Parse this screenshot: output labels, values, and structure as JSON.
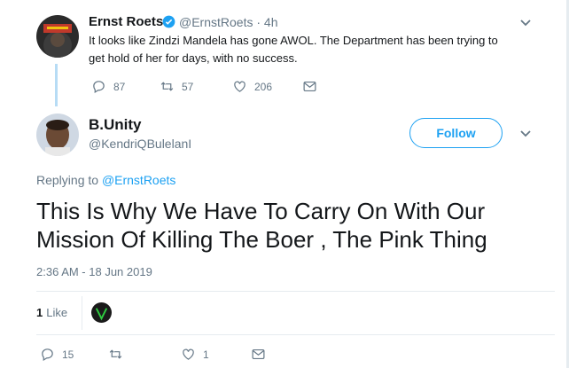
{
  "original_tweet": {
    "display_name": "Ernst Roets",
    "handle_time": "@ErnstRoets · 4h",
    "text": "It looks like Zindzi Mandela has gone AWOL. The Department has been trying to get hold of her for days, with no success.",
    "replies": "87",
    "retweets": "57",
    "likes": "206"
  },
  "reply_tweet": {
    "display_name": "B.Unity",
    "handle": "@KendriQBulelanI",
    "follow_label": "Follow",
    "replying_prefix": "Replying to",
    "replying_handle": "@ErnstRoets",
    "text": "This Is Why We Have To Carry On With Our Mission Of Killing The Boer , The Pink Thing",
    "timestamp": "2:36 AM - 18 Jun 2019",
    "like_count": "1",
    "like_label": "Like",
    "replies": "15",
    "retweets": "",
    "likes": "1"
  },
  "icons": [
    "reply-icon",
    "retweet-icon",
    "heart-icon",
    "message-icon",
    "verified-icon",
    "chevron-down-icon"
  ],
  "colors": {
    "accent": "#1da1f2",
    "muted": "#657786",
    "text": "#14171a",
    "thread": "#b7dcf5"
  }
}
